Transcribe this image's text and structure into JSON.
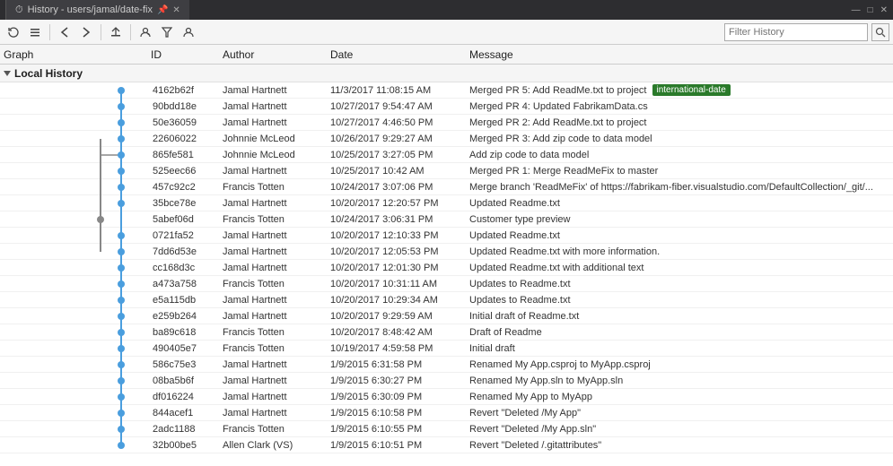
{
  "titleBar": {
    "title": "History - users/jamal/date-fix",
    "pinIcon": "📌",
    "closeIcon": "✕",
    "tabs": [
      {
        "label": "History - users/jamal/date-fix"
      }
    ]
  },
  "toolbar": {
    "buttons": [
      {
        "name": "refresh",
        "icon": "↺"
      },
      {
        "name": "show-list",
        "icon": "≡"
      },
      {
        "name": "back",
        "icon": "◂"
      },
      {
        "name": "forward",
        "icon": "▸"
      },
      {
        "name": "push-local",
        "icon": "↑"
      },
      {
        "name": "filter1",
        "icon": "▼"
      },
      {
        "name": "filter2",
        "icon": "⬟"
      },
      {
        "name": "person",
        "icon": "👤"
      }
    ],
    "filterPlaceholder": "Filter History",
    "searchIcon": "🔍"
  },
  "columns": {
    "graph": "Graph",
    "id": "ID",
    "author": "Author",
    "date": "Date",
    "message": "Message"
  },
  "sectionLabel": "Local History",
  "commits": [
    {
      "id": "4162b62f",
      "author": "Jamal Hartnett",
      "date": "11/3/2017 11:08:15 AM",
      "message": "Merged PR 5: Add ReadMe.txt to project",
      "tag": "international-date",
      "graphType": "main"
    },
    {
      "id": "90bdd18e",
      "author": "Jamal Hartnett",
      "date": "10/27/2017 9:54:47 AM",
      "message": "Merged PR 4: Updated FabrikamData.cs",
      "tag": "",
      "graphType": "main"
    },
    {
      "id": "50e36059",
      "author": "Jamal Hartnett",
      "date": "10/27/2017 4:46:50 PM",
      "message": "Merged PR 2: Add ReadMe.txt to project",
      "tag": "",
      "graphType": "main"
    },
    {
      "id": "22606022",
      "author": "Johnnie McLeod",
      "date": "10/26/2017 9:29:27 AM",
      "message": "Merged PR 3: Add zip code to data model",
      "tag": "",
      "graphType": "main"
    },
    {
      "id": "865fe581",
      "author": "Johnnie McLeod",
      "date": "10/25/2017 3:27:05 PM",
      "message": "Add zip code to data model",
      "tag": "",
      "graphType": "branch-merge"
    },
    {
      "id": "525eec66",
      "author": "Jamal Hartnett",
      "date": "10/25/2017 10:42 AM",
      "message": "Merged PR 1: Merge ReadMeFix to master",
      "tag": "",
      "graphType": "main"
    },
    {
      "id": "457c92c2",
      "author": "Francis Totten",
      "date": "10/24/2017 3:07:06 PM",
      "message": "Merge branch 'ReadMeFix' of https://fabrikam-fiber.visualstudio.com/DefaultCollection/_git/...",
      "tag": "",
      "graphType": "main"
    },
    {
      "id": "35bce78e",
      "author": "Jamal Hartnett",
      "date": "10/20/2017 12:20:57 PM",
      "message": "Updated Readme.txt",
      "tag": "",
      "graphType": "main"
    },
    {
      "id": "5abef06d",
      "author": "Francis Totten",
      "date": "10/24/2017 3:06:31 PM",
      "message": "Customer type preview",
      "tag": "",
      "graphType": "branch"
    },
    {
      "id": "0721fa52",
      "author": "Jamal Hartnett",
      "date": "10/20/2017 12:10:33 PM",
      "message": "Updated Readme.txt",
      "tag": "",
      "graphType": "main"
    },
    {
      "id": "7dd6d53e",
      "author": "Jamal Hartnett",
      "date": "10/20/2017 12:05:53 PM",
      "message": "Updated Readme.txt with more information.",
      "tag": "",
      "graphType": "main"
    },
    {
      "id": "cc168d3c",
      "author": "Jamal Hartnett",
      "date": "10/20/2017 12:01:30 PM",
      "message": "Updated Readme.txt with additional text",
      "tag": "",
      "graphType": "main"
    },
    {
      "id": "a473a758",
      "author": "Francis Totten",
      "date": "10/20/2017 10:31:11 AM",
      "message": "Updates to Readme.txt",
      "tag": "",
      "graphType": "main"
    },
    {
      "id": "e5a115db",
      "author": "Jamal Hartnett",
      "date": "10/20/2017 10:29:34 AM",
      "message": "Updates to Readme.txt",
      "tag": "",
      "graphType": "main"
    },
    {
      "id": "e259b264",
      "author": "Jamal Hartnett",
      "date": "10/20/2017 9:29:59 AM",
      "message": "Initial draft of Readme.txt",
      "tag": "",
      "graphType": "main"
    },
    {
      "id": "ba89c618",
      "author": "Francis Totten",
      "date": "10/20/2017 8:48:42 AM",
      "message": "Draft of Readme",
      "tag": "",
      "graphType": "main"
    },
    {
      "id": "490405e7",
      "author": "Francis Totten",
      "date": "10/19/2017 4:59:58 PM",
      "message": "Initial draft",
      "tag": "",
      "graphType": "main"
    },
    {
      "id": "586c75e3",
      "author": "Jamal Hartnett",
      "date": "1/9/2015 6:31:58 PM",
      "message": "Renamed My App.csproj to MyApp.csproj",
      "tag": "",
      "graphType": "main"
    },
    {
      "id": "08ba5b6f",
      "author": "Jamal Hartnett",
      "date": "1/9/2015 6:30:27 PM",
      "message": "Renamed My App.sln to MyApp.sln",
      "tag": "",
      "graphType": "main"
    },
    {
      "id": "df016224",
      "author": "Jamal Hartnett",
      "date": "1/9/2015 6:30:09 PM",
      "message": "Renamed My App to MyApp",
      "tag": "",
      "graphType": "main"
    },
    {
      "id": "844acef1",
      "author": "Jamal Hartnett",
      "date": "1/9/2015 6:10:58 PM",
      "message": "Revert \"Deleted /My App\"",
      "tag": "",
      "graphType": "main"
    },
    {
      "id": "2adc1188",
      "author": "Francis Totten",
      "date": "1/9/2015 6:10:55 PM",
      "message": "Revert \"Deleted /My App.sln\"",
      "tag": "",
      "graphType": "main"
    },
    {
      "id": "32b00be5",
      "author": "Allen Clark (VS)",
      "date": "1/9/2015 6:10:51 PM",
      "message": "Revert \"Deleted /.gitattributes\"",
      "tag": "",
      "graphType": "main"
    }
  ],
  "colors": {
    "mainLine": "#4a9ede",
    "branchLine": "#888",
    "tagBg": "#2a7a2a",
    "nodeColor": "#4a9ede"
  }
}
